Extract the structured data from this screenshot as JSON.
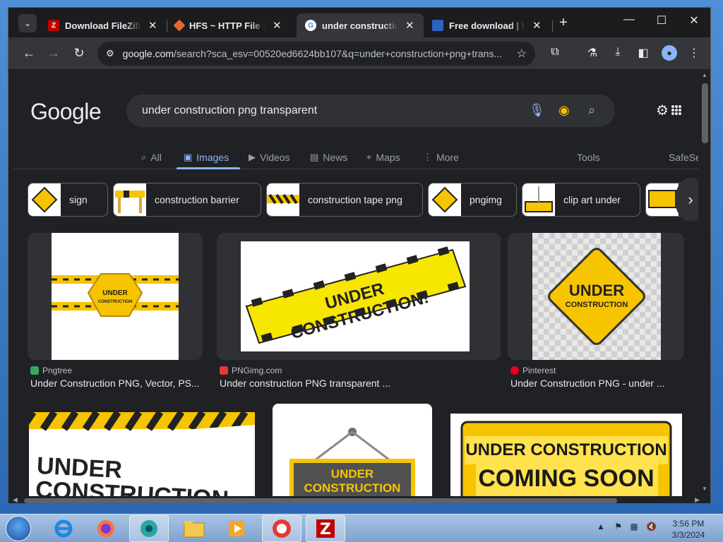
{
  "window": {
    "tabs": [
      {
        "title": "Download FileZilla C",
        "active": false
      },
      {
        "title": "HFS ~ HTTP File Ser",
        "active": false
      },
      {
        "title": "under construction p",
        "active": true
      },
      {
        "title": "Free download | Und",
        "active": false
      }
    ],
    "new_tab": "+",
    "controls": {
      "minimize": "—",
      "maximize": "☐",
      "close": "✕"
    }
  },
  "toolbar": {
    "url_host": "google.com",
    "url_rest": "/search?sca_esv=00520ed6624bb107&q=under+construction+png+trans..."
  },
  "google": {
    "logo": "Google",
    "query": "under construction png transparent",
    "tabs": [
      {
        "label": "All",
        "icon": "search-icon",
        "active": false
      },
      {
        "label": "Images",
        "icon": "image-icon",
        "active": true
      },
      {
        "label": "Videos",
        "icon": "video-icon",
        "active": false
      },
      {
        "label": "News",
        "icon": "news-icon",
        "active": false
      },
      {
        "label": "Maps",
        "icon": "map-pin-icon",
        "active": false
      },
      {
        "label": "More",
        "icon": "more-icon",
        "active": false
      }
    ],
    "tools": "Tools",
    "safesearch": "SafeSe",
    "chips": [
      {
        "label": "sign"
      },
      {
        "label": "construction barrier"
      },
      {
        "label": "construction tape png"
      },
      {
        "label": "pngimg"
      },
      {
        "label": "clip art under"
      }
    ],
    "results": [
      {
        "source": "Pngtree",
        "title": "Under Construction PNG, Vector, PS...",
        "img_text": [
          "UNDER",
          "CONSTRUCTION"
        ]
      },
      {
        "source": "PNGimg.com",
        "title": "Under construction PNG transparent ...",
        "img_text": [
          "UNDER CONSTRUCTION!"
        ]
      },
      {
        "source": "Pinterest",
        "title": "Under Construction PNG - under ...",
        "img_text": [
          "UNDER",
          "CONSTRUCTION"
        ]
      },
      {
        "source": "",
        "title": "",
        "img_text": [
          "UNDER",
          "CONSTRUCTION"
        ]
      },
      {
        "source": "",
        "title": "",
        "img_text": [
          "UNDER",
          "CONSTRUCTION"
        ]
      },
      {
        "source": "",
        "title": "",
        "img_text": [
          "UNDER CONSTRUCTION",
          "COMING SOON"
        ]
      }
    ]
  },
  "taskbar": {
    "clock_time": "3:56 PM",
    "clock_date": "3/3/2024"
  }
}
